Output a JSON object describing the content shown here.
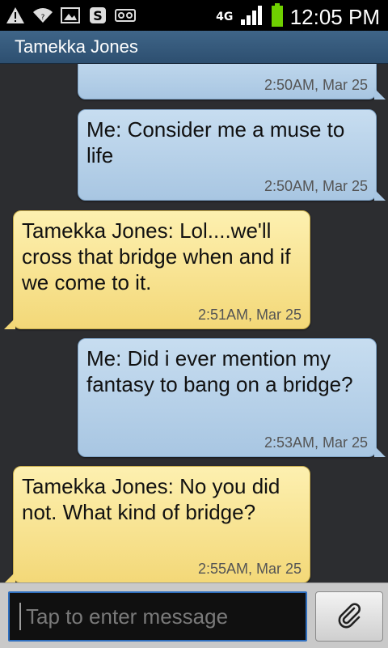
{
  "status_bar": {
    "icons": [
      "warning-icon",
      "wifi-icon",
      "gallery-icon",
      "app-s-icon",
      "voicemail-icon"
    ],
    "network": "4G",
    "time": "12:05 PM"
  },
  "header": {
    "title": "Tamekka Jones"
  },
  "messages": [
    {
      "direction": "out",
      "text": "",
      "time": "2:50AM, Mar 25"
    },
    {
      "direction": "out",
      "text": "Me: Consider me a muse to life",
      "time": "2:50AM, Mar 25"
    },
    {
      "direction": "in",
      "text": "Tamekka Jones: Lol....we'll cross that bridge when and if we come to it.",
      "time": "2:51AM, Mar 25"
    },
    {
      "direction": "out",
      "text": "Me: Did i ever mention my fantasy to bang on a bridge?",
      "time": "2:53AM, Mar 25"
    },
    {
      "direction": "in",
      "text": "Tamekka Jones: No you did not.  What kind of bridge?",
      "time": "2:55AM, Mar 25"
    }
  ],
  "composer": {
    "placeholder": "Tap to enter message",
    "value": "",
    "attach_icon": "paperclip-icon"
  },
  "colors": {
    "outgoing_bubble": "#b8d2ea",
    "incoming_bubble": "#f8e394",
    "header": "#35597b",
    "background": "#2c2d30"
  }
}
